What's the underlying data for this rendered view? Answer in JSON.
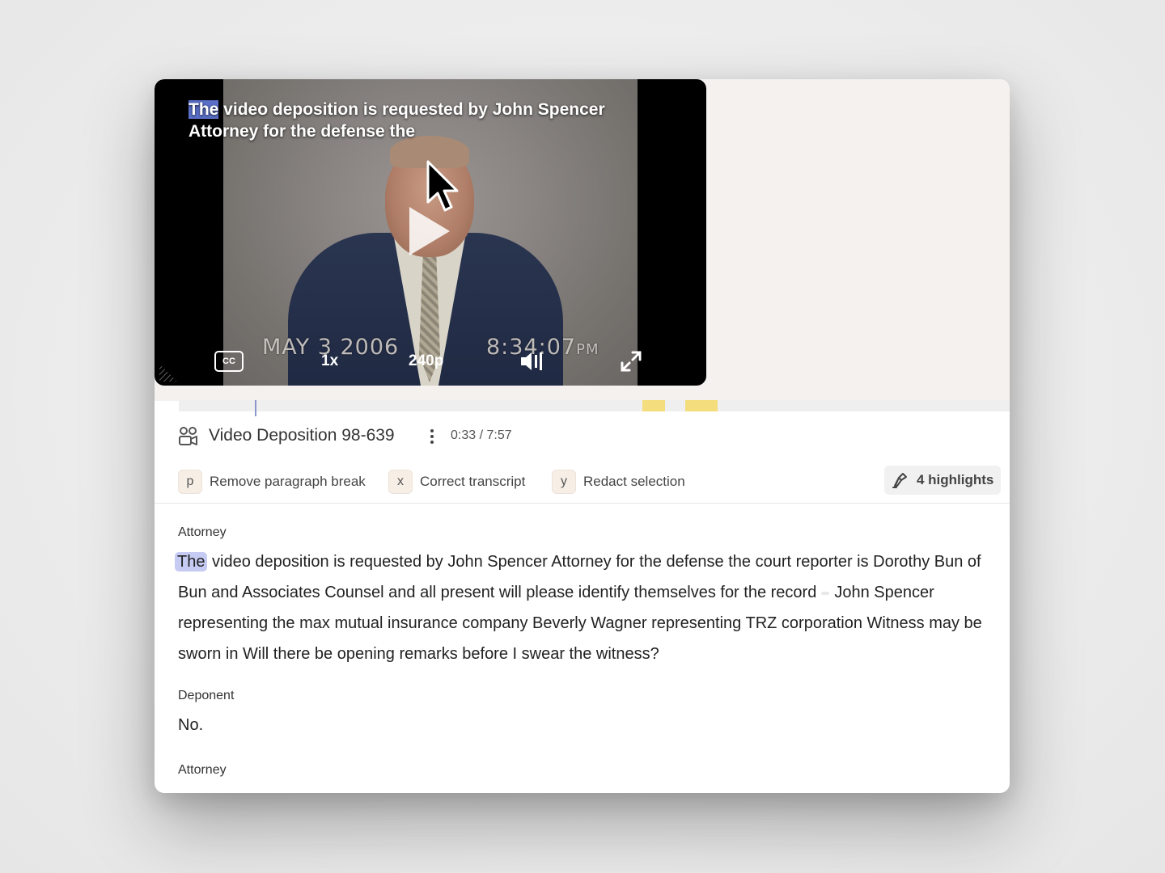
{
  "video": {
    "caption_highlight": "The",
    "caption_rest": " video deposition is requested by John Spencer Attorney for the defense the",
    "timestamp_date": "MAY  3 2006",
    "timestamp_time": "8:34:07",
    "timestamp_ampm": "PM",
    "cc_label": "CC",
    "speed_label": "1x",
    "quality_label": "240p",
    "icons": [
      "play-icon",
      "cursor-icon",
      "cc-icon",
      "volume-icon",
      "fullscreen-icon"
    ]
  },
  "timeline": {
    "progress": 0.07,
    "highlight_colors": "#f3dd7c"
  },
  "header": {
    "title": "Video Deposition 98-639",
    "timecode": "0:33 / 7:57",
    "shortcuts": [
      {
        "key": "p",
        "label": "Remove paragraph break"
      },
      {
        "key": "x",
        "label": "Correct transcript"
      },
      {
        "key": "y",
        "label": "Redact selection"
      }
    ],
    "highlights_label": "4 highlights"
  },
  "transcript": [
    {
      "speaker": "Attorney",
      "highlight_word": "The",
      "text_part1": " video deposition is requested by John Spencer Attorney for the defense the court reporter is Dorothy Bun of Bun and Associates Counsel and all present will please identify themselves for the record",
      "text_part2": "John Spencer representing the max mutual insurance company Beverly Wagner representing TRZ corporation Witness may be sworn in Will there be opening remarks before I swear the witness?"
    },
    {
      "speaker": "Deponent",
      "text": "No."
    },
    {
      "speaker": "Attorney"
    }
  ],
  "colors": {
    "accent_highlight": "#c5cbf3",
    "caption_highlight": "#5a6fc8",
    "shortcut_key_bg": "#f7eee6"
  }
}
